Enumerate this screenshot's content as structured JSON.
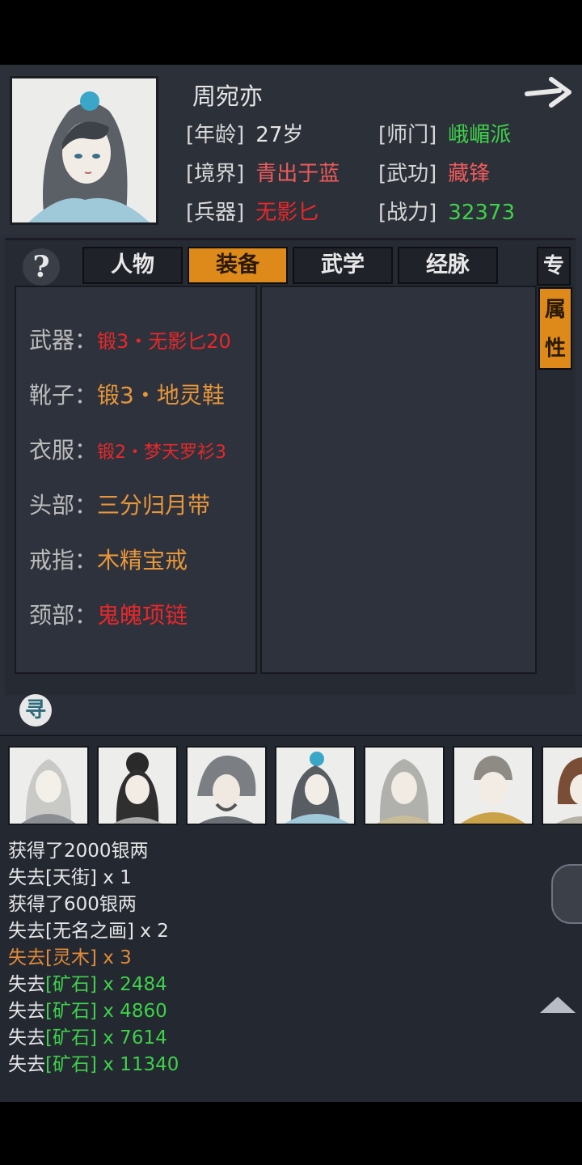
{
  "header": {
    "name": "周宛亦",
    "stats": {
      "age": {
        "label": "[年龄]",
        "value": "27岁"
      },
      "sect": {
        "label": "[师门]",
        "value": "峨嵋派"
      },
      "realm": {
        "label": "[境界]",
        "value": "青出于蓝"
      },
      "skill": {
        "label": "[武功]",
        "value": "藏锋"
      },
      "weapon": {
        "label": "[兵器]",
        "value": "无影匕"
      },
      "power": {
        "label": "[战力]",
        "value": "32373"
      }
    }
  },
  "tabs": [
    "人物",
    "装备",
    "武学",
    "经脉"
  ],
  "side_tabs": {
    "inactive": "专",
    "active_top": "属",
    "active_bottom": "性"
  },
  "help_label": "?",
  "seek_label": "寻",
  "equipment": [
    {
      "slot": "武器：",
      "item": "锻3・无影匕20"
    },
    {
      "slot": "靴子：",
      "item": "锻3・地灵鞋"
    },
    {
      "slot": "衣服：",
      "item": "锻2・梦天罗衫3"
    },
    {
      "slot": "头部：",
      "item": "三分归月带"
    },
    {
      "slot": "戒指：",
      "item": "木精宝戒"
    },
    {
      "slot": "颈部：",
      "item": "鬼魄项链"
    }
  ],
  "log": [
    {
      "pre": "获得了2000银两",
      "item": "",
      "post": ""
    },
    {
      "pre": "失去",
      "item": "[天街]",
      "post": " x 1"
    },
    {
      "pre": "获得了600银两",
      "item": "",
      "post": ""
    },
    {
      "pre": "失去",
      "item": "[无名之画]",
      "post": " x 2"
    },
    {
      "pre": "失去",
      "item": "[灵木]",
      "post": " x 3"
    },
    {
      "pre": "失去",
      "item": "[矿石]",
      "post": " x 2484"
    },
    {
      "pre": "失去",
      "item": "[矿石]",
      "post": " x 4860"
    },
    {
      "pre": "失去",
      "item": "[矿石]",
      "post": " x 7614"
    },
    {
      "pre": "失去",
      "item": "[矿石]",
      "post": " x 11340"
    }
  ],
  "colors": {
    "label": "#d8d8d8",
    "white": "#e6e6e6",
    "green": "#3ed24a",
    "red": "#e8282a",
    "pink_red": "#ef5b5b",
    "orange": "#e8963a",
    "orange_log": "#e08a3a",
    "accent_tab": "#dd8a1a"
  }
}
